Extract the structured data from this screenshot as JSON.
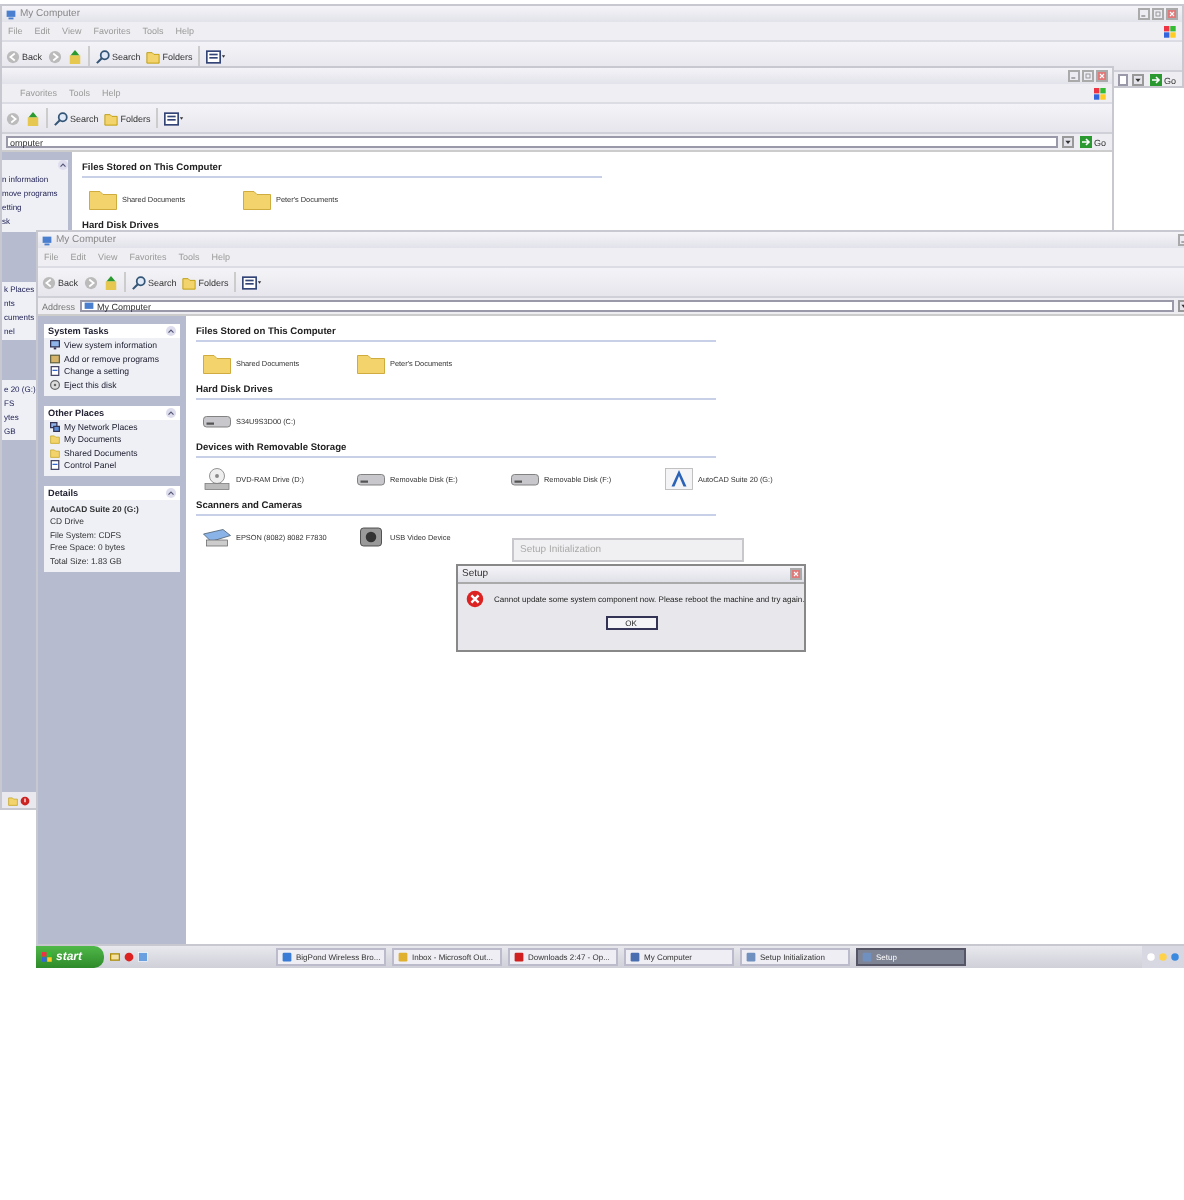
{
  "back_window": {
    "title": "My Computer",
    "menu": [
      "File",
      "Edit",
      "View",
      "Favorites",
      "Tools",
      "Help"
    ],
    "toolbar": {
      "back": "Back",
      "search": "Search",
      "folders": "Folders"
    },
    "go": "Go"
  },
  "middle_window": {
    "menu": [
      "Favorites",
      "Tools",
      "Help"
    ],
    "toolbar": {
      "search": "Search",
      "folders": "Folders"
    },
    "address": "omputer",
    "go": "Go",
    "pane_top": [
      "n information",
      "move programs",
      "etting",
      "sk"
    ],
    "pane_places": [
      "k Places",
      "nts",
      "cuments",
      "nel"
    ],
    "pane_details": [
      "e 20 (G:)",
      "FS",
      "ytes",
      "GB"
    ],
    "sections": [
      {
        "heading": "Files Stored on This Computer",
        "items": [
          {
            "label": "Shared Documents",
            "kind": "folder"
          },
          {
            "label": "Peter's Documents",
            "kind": "folder"
          }
        ]
      },
      {
        "heading": "Hard Disk Drives"
      }
    ]
  },
  "front_window": {
    "title": "My Computer",
    "menu": [
      "File",
      "Edit",
      "View",
      "Favorites",
      "Tools",
      "Help"
    ],
    "toolbar": {
      "back": "Back",
      "search": "Search",
      "folders": "Folders"
    },
    "address_label": "Address",
    "address": "My Computer",
    "panes": [
      {
        "title": "System Tasks",
        "kind": "links",
        "items": [
          {
            "label": "View system information",
            "kind": "info"
          },
          {
            "label": "Add or remove programs",
            "kind": "addremove"
          },
          {
            "label": "Change a setting",
            "kind": "setting"
          },
          {
            "label": "Eject this disk",
            "kind": "eject"
          }
        ]
      },
      {
        "title": "Other Places",
        "kind": "links",
        "items": [
          {
            "label": "My Network Places",
            "kind": "network"
          },
          {
            "label": "My Documents",
            "kind": "folder"
          },
          {
            "label": "Shared Documents",
            "kind": "folder"
          },
          {
            "label": "Control Panel",
            "kind": "setting"
          }
        ]
      },
      {
        "title": "Details",
        "kind": "details",
        "lines": [
          "AutoCAD Suite 20 (G:)",
          "CD Drive",
          "File System: CDFS",
          "Free Space: 0 bytes",
          "Total Size: 1.83 GB"
        ]
      }
    ],
    "sections": [
      {
        "heading": "Files Stored on This Computer",
        "items": [
          {
            "label": "Shared Documents",
            "kind": "folder"
          },
          {
            "label": "Peter's Documents",
            "kind": "folder"
          }
        ]
      },
      {
        "heading": "Hard Disk Drives",
        "items": [
          {
            "label": "S34U9S3D00 (C:)",
            "kind": "hdd"
          }
        ]
      },
      {
        "heading": "Devices with Removable Storage",
        "items": [
          {
            "label": "DVD-RAM Drive (D:)",
            "kind": "dvd"
          },
          {
            "label": "Removable Disk (E:)",
            "kind": "hdd"
          },
          {
            "label": "Removable Disk (F:)",
            "kind": "hdd"
          },
          {
            "label": "AutoCAD Suite 20 (G:)",
            "kind": "cd"
          }
        ]
      },
      {
        "heading": "Scanners and Cameras",
        "items": [
          {
            "label": "EPSON (8082) 8082 F7830",
            "kind": "scanner"
          },
          {
            "label": "USB Video Device",
            "kind": "camera"
          }
        ]
      }
    ]
  },
  "setup_initialization": {
    "title": "Setup Initialization"
  },
  "setup_dialog": {
    "title": "Setup",
    "message": "Cannot update some system component now. Please reboot the machine and try again.",
    "button": "OK"
  },
  "taskbar": {
    "start": "start",
    "tasks": [
      {
        "label": "BigPond Wireless Bro...",
        "kind": "network",
        "selected": false
      },
      {
        "label": "Inbox - Microsoft Out...",
        "kind": "mail",
        "selected": false
      },
      {
        "label": "Downloads 2:47 - Op...",
        "kind": "browser",
        "selected": false
      },
      {
        "label": "My Computer",
        "kind": "computer",
        "selected": false
      },
      {
        "label": "Setup Initialization",
        "kind": "setup",
        "selected": false
      },
      {
        "label": "Setup",
        "kind": "setup",
        "selected": true
      }
    ]
  }
}
